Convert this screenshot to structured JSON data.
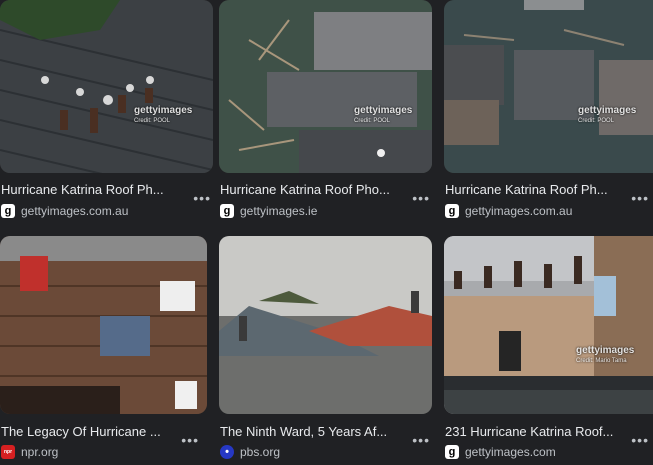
{
  "results": [
    {
      "title": "Hurricane Katrina Roof Ph...",
      "source": "gettyimages.com.au",
      "source_icon": "getty-g-icon",
      "watermark": "gettyimages",
      "credit": "Credit: POOL",
      "more": "•••"
    },
    {
      "title": "Hurricane Katrina Roof Pho...",
      "source": "gettyimages.ie",
      "source_icon": "getty-g-icon",
      "watermark": "gettyimages",
      "credit": "Credit: POOL",
      "more": "•••"
    },
    {
      "title": "Hurricane Katrina Roof Ph...",
      "source": "gettyimages.com.au",
      "source_icon": "getty-g-icon",
      "watermark": "gettyimages",
      "credit": "Credit: POOL",
      "more": "•••"
    },
    {
      "title": "The Legacy Of Hurricane ...",
      "source": "npr.org",
      "source_icon": "npr-icon",
      "more": "•••"
    },
    {
      "title": "The Ninth Ward, 5 Years Af...",
      "source": "pbs.org",
      "source_icon": "pbs-icon",
      "more": "•••"
    },
    {
      "title": "231 Hurricane Katrina Roof...",
      "source": "gettyimages.com",
      "source_icon": "getty-g-icon",
      "watermark": "gettyimages",
      "credit": "Credit: Mario Tama",
      "more": "•••"
    }
  ],
  "icons": {
    "getty": "g",
    "npr": "npr",
    "pbs": "•"
  },
  "colors": {
    "background": "#202124",
    "text": "#e8eaed",
    "muted": "#bdc1c6",
    "npr_red": "#d62021",
    "pbs_blue": "#2638c4"
  }
}
